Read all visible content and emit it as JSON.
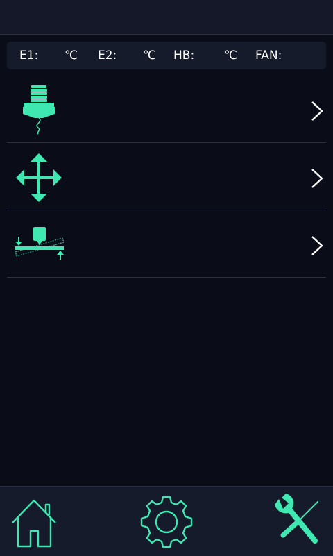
{
  "status_bar": {
    "e1_label": "E1:",
    "e1_unit": "℃",
    "e2_label": "E2:",
    "e2_unit": "℃",
    "hb_label": "HB:",
    "hb_unit": "℃",
    "fan_label": "FAN:"
  },
  "menu": {
    "items": [
      {
        "icon": "extruder-nozzle-icon",
        "action": "chevron-right-icon"
      },
      {
        "icon": "move-axes-icon",
        "action": "chevron-right-icon"
      },
      {
        "icon": "bed-leveling-icon",
        "action": "chevron-right-icon"
      }
    ]
  },
  "bottom_nav": {
    "items": [
      {
        "icon": "home-icon"
      },
      {
        "icon": "gear-icon"
      },
      {
        "icon": "tools-icon"
      }
    ]
  },
  "colors": {
    "accent": "#3ee8b0",
    "background": "#0a0d18",
    "panel": "#161b2c",
    "divider": "#2b3142",
    "text": "#ffffff"
  }
}
